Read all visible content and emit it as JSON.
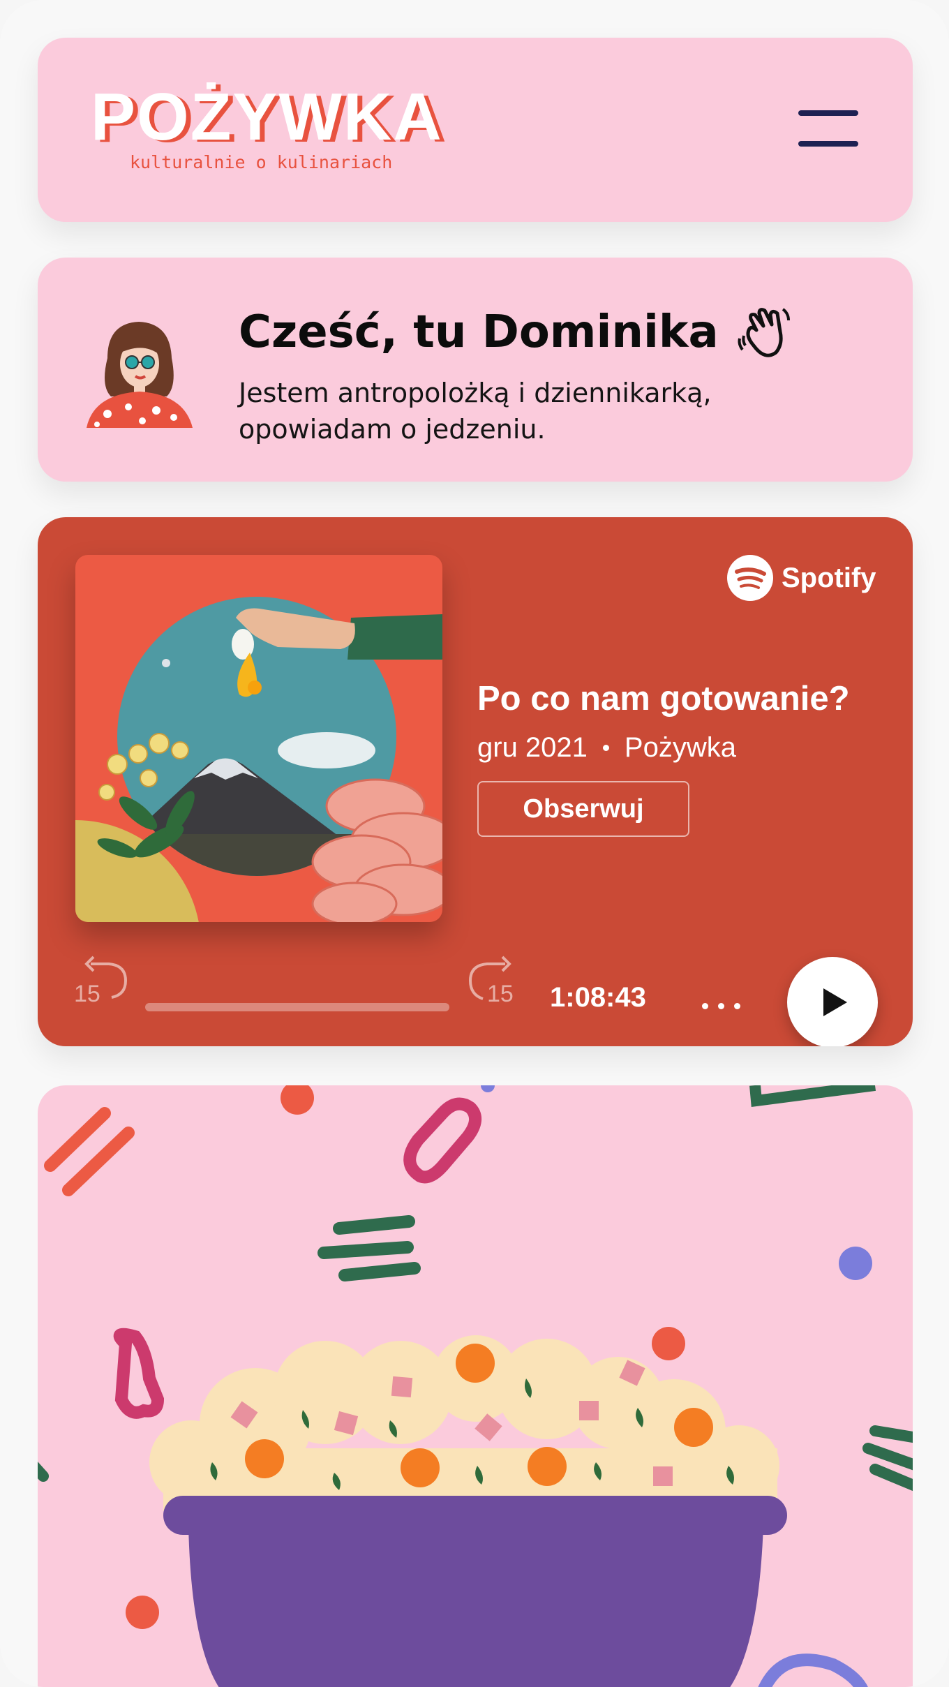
{
  "header": {
    "logo_word": "POŻYWKA",
    "tagline": "kulturalnie o kulinariach",
    "menu_icon": "hamburger-menu-icon"
  },
  "intro": {
    "greeting": "Cześć, tu Dominika",
    "greeting_icon": "waving-hand-icon",
    "text": "Jestem antropolożką i dziennikarką, opowiadam o jedzeniu."
  },
  "player": {
    "brand": "Spotify",
    "episode_title": "Po co nam gotowanie?",
    "date": "gru 2021",
    "show": "Pożywka",
    "follow_label": "Obserwuj",
    "skip_back_label": "15",
    "skip_forward_label": "15",
    "duration": "1:08:43",
    "progress": 0
  },
  "colors": {
    "pink": "#fbcbdc",
    "accent_red": "#e8523f",
    "player_bg": "#ca4a36",
    "navy": "#1d2152",
    "bowl": "#6d4c9d"
  }
}
